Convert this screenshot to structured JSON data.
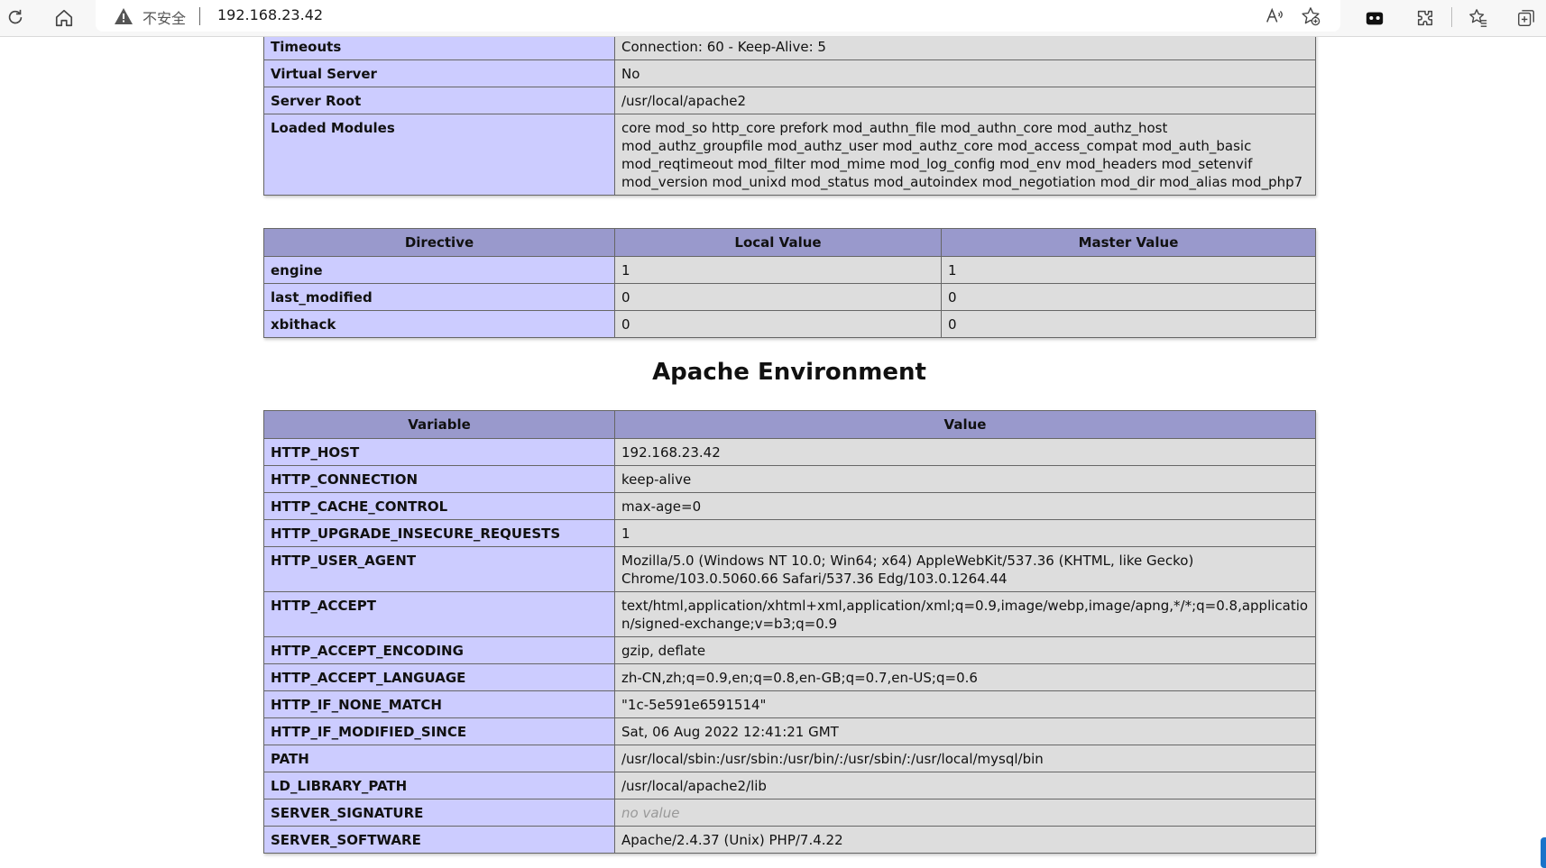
{
  "browser": {
    "insecure_label": "不安全",
    "url": "192.168.23.42",
    "icons": [
      "refresh-icon",
      "home-icon",
      "warning-icon",
      "read-aloud-icon",
      "favorite-add-icon",
      "games-icon",
      "extensions-icon",
      "favorites-icon",
      "collections-icon"
    ]
  },
  "server_config": {
    "rows": [
      {
        "name": "Timeouts",
        "value": "Connection: 60 - Keep-Alive: 5"
      },
      {
        "name": "Virtual Server",
        "value": "No"
      },
      {
        "name": "Server Root",
        "value": "/usr/local/apache2"
      },
      {
        "name": "Loaded Modules",
        "value": "core mod_so http_core prefork mod_authn_file mod_authn_core mod_authz_host mod_authz_groupfile mod_authz_user mod_authz_core mod_access_compat mod_auth_basic mod_reqtimeout mod_filter mod_mime mod_log_config mod_env mod_headers mod_setenvif mod_version mod_unixd mod_status mod_autoindex mod_negotiation mod_dir mod_alias mod_php7"
      }
    ]
  },
  "directives": {
    "headers": [
      "Directive",
      "Local Value",
      "Master Value"
    ],
    "rows": [
      {
        "name": "engine",
        "local": "1",
        "master": "1"
      },
      {
        "name": "last_modified",
        "local": "0",
        "master": "0"
      },
      {
        "name": "xbithack",
        "local": "0",
        "master": "0"
      }
    ]
  },
  "apache_env": {
    "title": "Apache Environment",
    "headers": [
      "Variable",
      "Value"
    ],
    "rows": [
      {
        "name": "HTTP_HOST",
        "value": "192.168.23.42"
      },
      {
        "name": "HTTP_CONNECTION",
        "value": "keep-alive"
      },
      {
        "name": "HTTP_CACHE_CONTROL",
        "value": "max-age=0"
      },
      {
        "name": "HTTP_UPGRADE_INSECURE_REQUESTS",
        "value": "1"
      },
      {
        "name": "HTTP_USER_AGENT",
        "value": "Mozilla/5.0 (Windows NT 10.0; Win64; x64) AppleWebKit/537.36 (KHTML, like Gecko) Chrome/103.0.5060.66 Safari/537.36 Edg/103.0.1264.44"
      },
      {
        "name": "HTTP_ACCEPT",
        "value": "text/html,application/xhtml+xml,application/xml;q=0.9,image/webp,image/apng,*/*;q=0.8,application/signed-exchange;v=b3;q=0.9"
      },
      {
        "name": "HTTP_ACCEPT_ENCODING",
        "value": "gzip, deflate"
      },
      {
        "name": "HTTP_ACCEPT_LANGUAGE",
        "value": "zh-CN,zh;q=0.9,en;q=0.8,en-GB;q=0.7,en-US;q=0.6"
      },
      {
        "name": "HTTP_IF_NONE_MATCH",
        "value": "\"1c-5e591e6591514\""
      },
      {
        "name": "HTTP_IF_MODIFIED_SINCE",
        "value": "Sat, 06 Aug 2022 12:41:21 GMT"
      },
      {
        "name": "PATH",
        "value": "/usr/local/sbin:/usr/sbin:/usr/bin/:/usr/sbin/:/usr/local/mysql/bin"
      },
      {
        "name": "LD_LIBRARY_PATH",
        "value": "/usr/local/apache2/lib"
      },
      {
        "name": "SERVER_SIGNATURE",
        "value": "no value"
      },
      {
        "name": "SERVER_SOFTWARE",
        "value": "Apache/2.4.37 (Unix) PHP/7.4.22"
      }
    ]
  }
}
